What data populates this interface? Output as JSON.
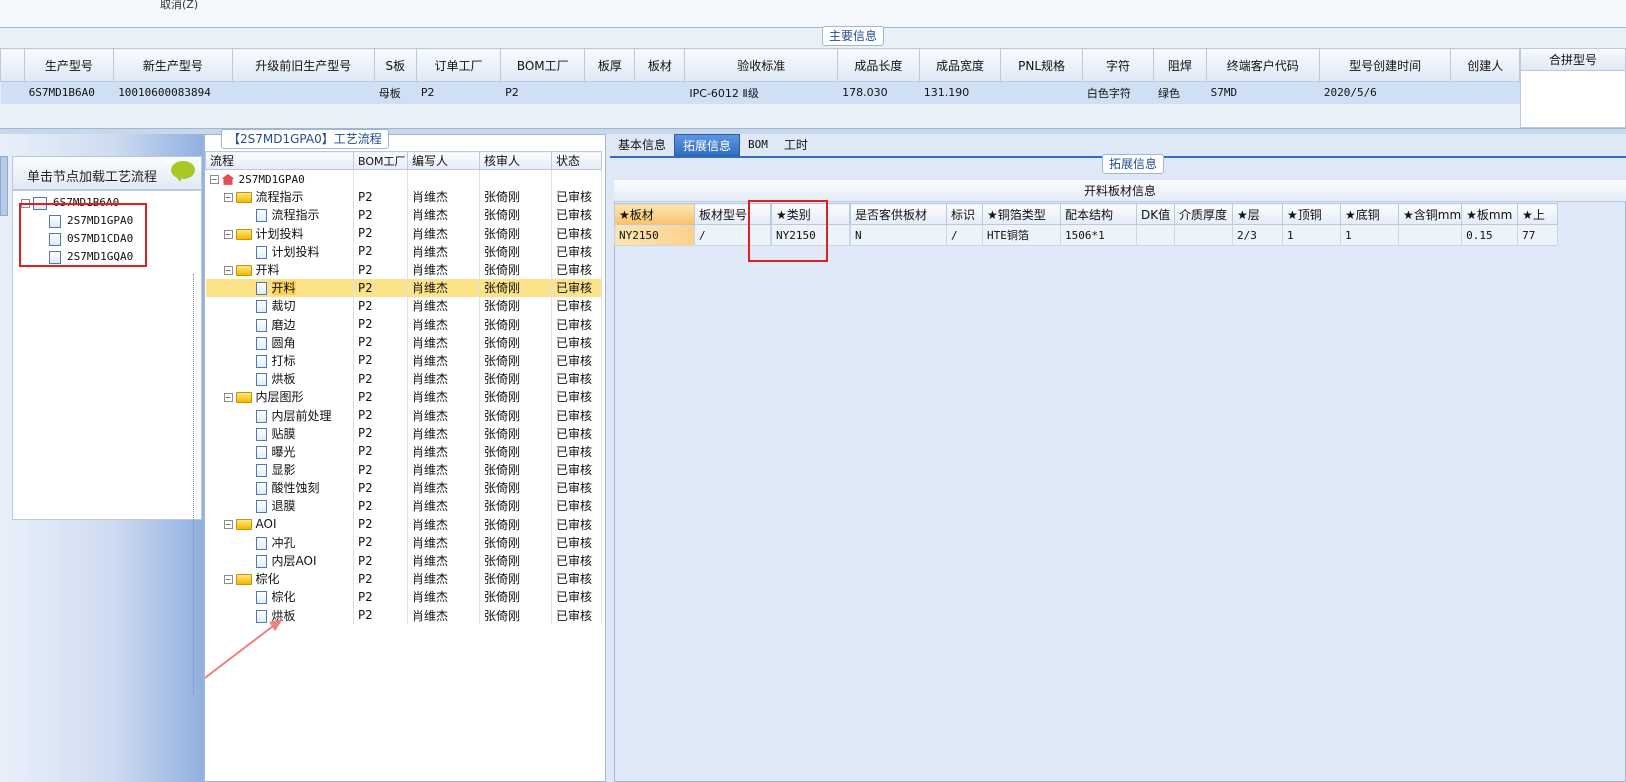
{
  "topbar": {
    "cancel_label": "取消(Z)"
  },
  "main_info": {
    "title": "主要信息",
    "columns": [
      "生产型号",
      "新生产型号",
      "升级前旧生产型号",
      "S板",
      "订单工厂",
      "BOM工厂",
      "板厚",
      "板材",
      "验收标准",
      "成品长度",
      "成品宽度",
      "PNL规格",
      "字符",
      "阻焊",
      "终端客户代码",
      "型号创建时间",
      "创建人"
    ],
    "row": [
      "6S7MD1B6A0",
      "10010600083894",
      "",
      "母板",
      "P2",
      "P2",
      "",
      "",
      "IPC-6012 Ⅱ级",
      "178.030",
      "131.190",
      "",
      "白色字符",
      "绿色",
      "S7MD",
      "2020/5/6",
      ""
    ],
    "merge_header": "合拼型号"
  },
  "left_panel": {
    "header": "单击节点加载工艺流程",
    "tree": [
      {
        "label": "6S7MD1B6A0",
        "level": 0
      },
      {
        "label": "2S7MD1GPA0",
        "level": 1
      },
      {
        "label": "0S7MD1CDA0",
        "level": 1
      },
      {
        "label": "2S7MD1GQA0",
        "level": 1
      }
    ]
  },
  "process_panel": {
    "title": "【2S7MD1GPA0】工艺流程",
    "columns": [
      "流程",
      "BOM工厂",
      "编写人",
      "核审人",
      "状态"
    ],
    "root": "2S7MD1GPA0",
    "rows": [
      {
        "name": "流程指示",
        "type": "folder",
        "factory": "P2",
        "writer": "肖维杰",
        "reviewer": "张倚刚",
        "status": "已审核"
      },
      {
        "name": "流程指示",
        "type": "file",
        "factory": "P2",
        "writer": "肖维杰",
        "reviewer": "张倚刚",
        "status": "已审核"
      },
      {
        "name": "计划投料",
        "type": "folder",
        "factory": "P2",
        "writer": "肖维杰",
        "reviewer": "张倚刚",
        "status": "已审核"
      },
      {
        "name": "计划投料",
        "type": "file",
        "factory": "P2",
        "writer": "肖维杰",
        "reviewer": "张倚刚",
        "status": "已审核"
      },
      {
        "name": "开料",
        "type": "folder",
        "factory": "P2",
        "writer": "肖维杰",
        "reviewer": "张倚刚",
        "status": "已审核"
      },
      {
        "name": "开料",
        "type": "file",
        "factory": "P2",
        "writer": "肖维杰",
        "reviewer": "张倚刚",
        "status": "已审核",
        "selected": true
      },
      {
        "name": "裁切",
        "type": "file",
        "factory": "P2",
        "writer": "肖维杰",
        "reviewer": "张倚刚",
        "status": "已审核"
      },
      {
        "name": "磨边",
        "type": "file",
        "factory": "P2",
        "writer": "肖维杰",
        "reviewer": "张倚刚",
        "status": "已审核"
      },
      {
        "name": "圆角",
        "type": "file",
        "factory": "P2",
        "writer": "肖维杰",
        "reviewer": "张倚刚",
        "status": "已审核"
      },
      {
        "name": "打标",
        "type": "file",
        "factory": "P2",
        "writer": "肖维杰",
        "reviewer": "张倚刚",
        "status": "已审核"
      },
      {
        "name": "烘板",
        "type": "file",
        "factory": "P2",
        "writer": "肖维杰",
        "reviewer": "张倚刚",
        "status": "已审核"
      },
      {
        "name": "内层图形",
        "type": "folder",
        "factory": "P2",
        "writer": "肖维杰",
        "reviewer": "张倚刚",
        "status": "已审核"
      },
      {
        "name": "内层前处理",
        "type": "file",
        "factory": "P2",
        "writer": "肖维杰",
        "reviewer": "张倚刚",
        "status": "已审核"
      },
      {
        "name": "贴膜",
        "type": "file",
        "factory": "P2",
        "writer": "肖维杰",
        "reviewer": "张倚刚",
        "status": "已审核"
      },
      {
        "name": "曝光",
        "type": "file",
        "factory": "P2",
        "writer": "肖维杰",
        "reviewer": "张倚刚",
        "status": "已审核"
      },
      {
        "name": "显影",
        "type": "file",
        "factory": "P2",
        "writer": "肖维杰",
        "reviewer": "张倚刚",
        "status": "已审核"
      },
      {
        "name": "酸性蚀刻",
        "type": "file",
        "factory": "P2",
        "writer": "肖维杰",
        "reviewer": "张倚刚",
        "status": "已审核"
      },
      {
        "name": "退膜",
        "type": "file",
        "factory": "P2",
        "writer": "肖维杰",
        "reviewer": "张倚刚",
        "status": "已审核"
      },
      {
        "name": "AOI",
        "type": "folder",
        "factory": "P2",
        "writer": "肖维杰",
        "reviewer": "张倚刚",
        "status": "已审核"
      },
      {
        "name": "冲孔",
        "type": "file",
        "factory": "P2",
        "writer": "肖维杰",
        "reviewer": "张倚刚",
        "status": "已审核"
      },
      {
        "name": "内层AOI",
        "type": "file",
        "factory": "P2",
        "writer": "肖维杰",
        "reviewer": "张倚刚",
        "status": "已审核"
      },
      {
        "name": "棕化",
        "type": "folder",
        "factory": "P2",
        "writer": "肖维杰",
        "reviewer": "张倚刚",
        "status": "已审核"
      },
      {
        "name": "棕化",
        "type": "file",
        "factory": "P2",
        "writer": "肖维杰",
        "reviewer": "张倚刚",
        "status": "已审核"
      },
      {
        "name": "烘板",
        "type": "file",
        "factory": "P2",
        "writer": "肖维杰",
        "reviewer": "张倚刚",
        "status": "已审核"
      }
    ]
  },
  "right_panel": {
    "tabs": [
      "基本信息",
      "拓展信息",
      "BOM",
      "工时"
    ],
    "active_tab": "拓展信息",
    "ext_title": "拓展信息",
    "table_title": "开料板材信息",
    "columns": [
      "★板材",
      "板材型号",
      "",
      "★类别",
      "",
      "是否客供板材",
      "标识",
      "★铜箔类型",
      "配本结构",
      "DK值",
      "介质厚度",
      "★层",
      "★顶铜",
      "★底铜",
      "★含铜mm",
      "★板mm",
      "★上"
    ],
    "row": [
      "NY2150",
      "/",
      "",
      "NY2150",
      "",
      "N",
      "/",
      "HTE铜箔",
      "1506*1",
      "",
      "",
      "2/3",
      "1",
      "1",
      "",
      "0.15",
      "77"
    ]
  },
  "colors": {
    "highlight": "#e02020",
    "accent": "#2f6fc2",
    "selected_row": "#fce38a"
  }
}
